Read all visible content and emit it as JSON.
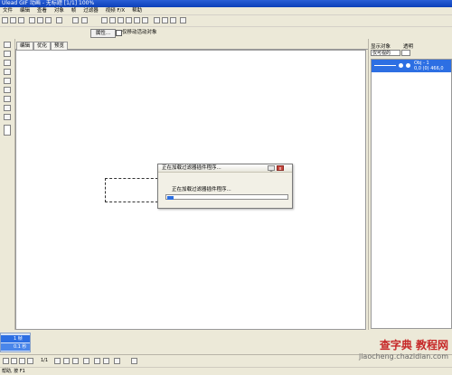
{
  "window": {
    "title": "Ulead GIF 动画 - 无标题 [1/1] 100%"
  },
  "menu": [
    "文件",
    "编辑",
    "查看",
    "对象",
    "帧",
    "过滤器",
    "视频 F/X",
    "帮助"
  ],
  "toolbar2": {
    "properties_label": "属性...",
    "checkbox_label": "仅移动活动对象"
  },
  "tabs": [
    "编辑",
    "优化",
    "预览"
  ],
  "dialog": {
    "title": "正在加载过滤器插件程序...",
    "message": "正在加载过滤器插件程序...",
    "progress": 0.05,
    "minimize_glyph": "_",
    "close_glyph": "x"
  },
  "right_panel": {
    "label1": "显示对象",
    "label2": "透明",
    "select1": "仅可视的",
    "item": {
      "name": "Obj - 1",
      "info": "0,0 (0) 466,0"
    }
  },
  "bottom_panel": {
    "row1": "1 帧",
    "row2": "0.1 秒"
  },
  "bottom_toolbar": {
    "frame_count": "1/1"
  },
  "status": {
    "text": "帮助, 按 F1"
  },
  "watermark": {
    "line1": "查字典 教程网",
    "line2": "jiaocheng.chazidian.com"
  },
  "colors": {
    "selection": "#2d6fe3",
    "titlebar": "#0b3fb8",
    "close": "#c7443b"
  }
}
